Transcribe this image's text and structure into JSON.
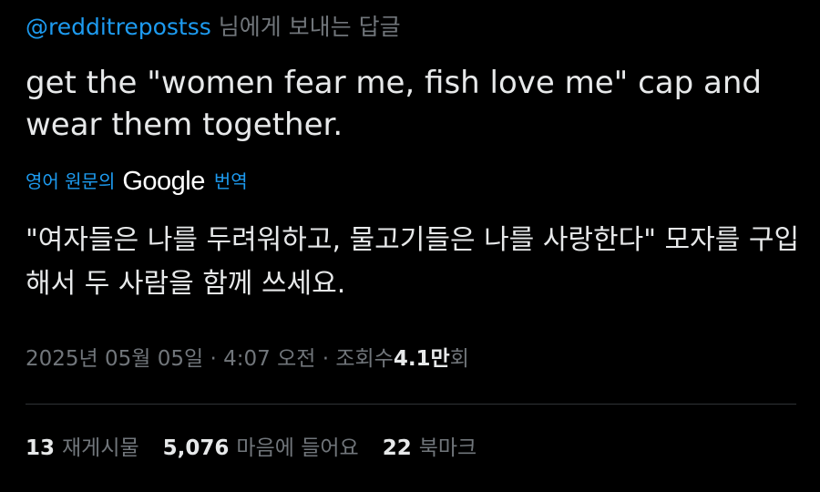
{
  "reply": {
    "handle": "@redditrepostss",
    "suffix": "님에게 보내는 답글"
  },
  "tweet": {
    "text": "get the \"women fear me, fish love me\" cap and wear them together."
  },
  "translation": {
    "prefix": "영어 원문의",
    "provider": "Google",
    "suffix": "번역",
    "text": "\"여자들은 나를 두려워하고, 물고기들은 나를 사랑한다\" 모자를 구입해서 두 사람을 함께 쓰세요."
  },
  "meta": {
    "date": "2025년 05월 05일",
    "separator1": "·",
    "time": "4:07 오전",
    "separator2": "·",
    "views_label": "조회수",
    "views_value": "4.1만",
    "views_suffix": "회"
  },
  "stats": [
    {
      "count": "13",
      "label": "재게시물"
    },
    {
      "count": "5,076",
      "label": "마음에 들어요"
    },
    {
      "count": "22",
      "label": "북마크"
    }
  ],
  "colors": {
    "background": "#000000",
    "text": "#e7e9ea",
    "muted": "#71767b",
    "link": "#1d9bf0",
    "divider": "#2f3336"
  }
}
